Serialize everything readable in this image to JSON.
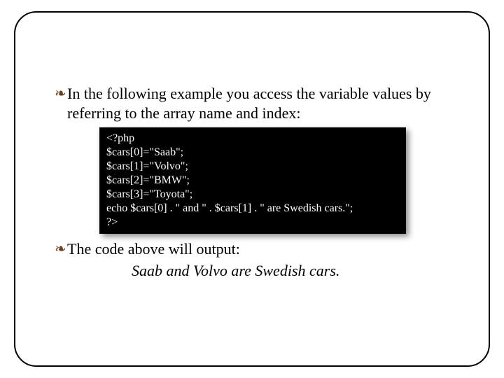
{
  "bullets": {
    "intro": "In the following example you access the variable values by referring to the array name and index:",
    "outro": "The code above will output:"
  },
  "code": {
    "l1": "<?php",
    "l2": "$cars[0]=\"Saab\";",
    "l3": "$cars[1]=\"Volvo\";",
    "l4": "$cars[2]=\"BMW\";",
    "l5": "$cars[3]=\"Toyota\";",
    "l6": "echo $cars[0] . \" and \" . $cars[1] . \" are Swedish cars.\";",
    "l7": "?>"
  },
  "output": "Saab and Volvo are Swedish cars.",
  "glyphs": {
    "bullet": "❧"
  }
}
